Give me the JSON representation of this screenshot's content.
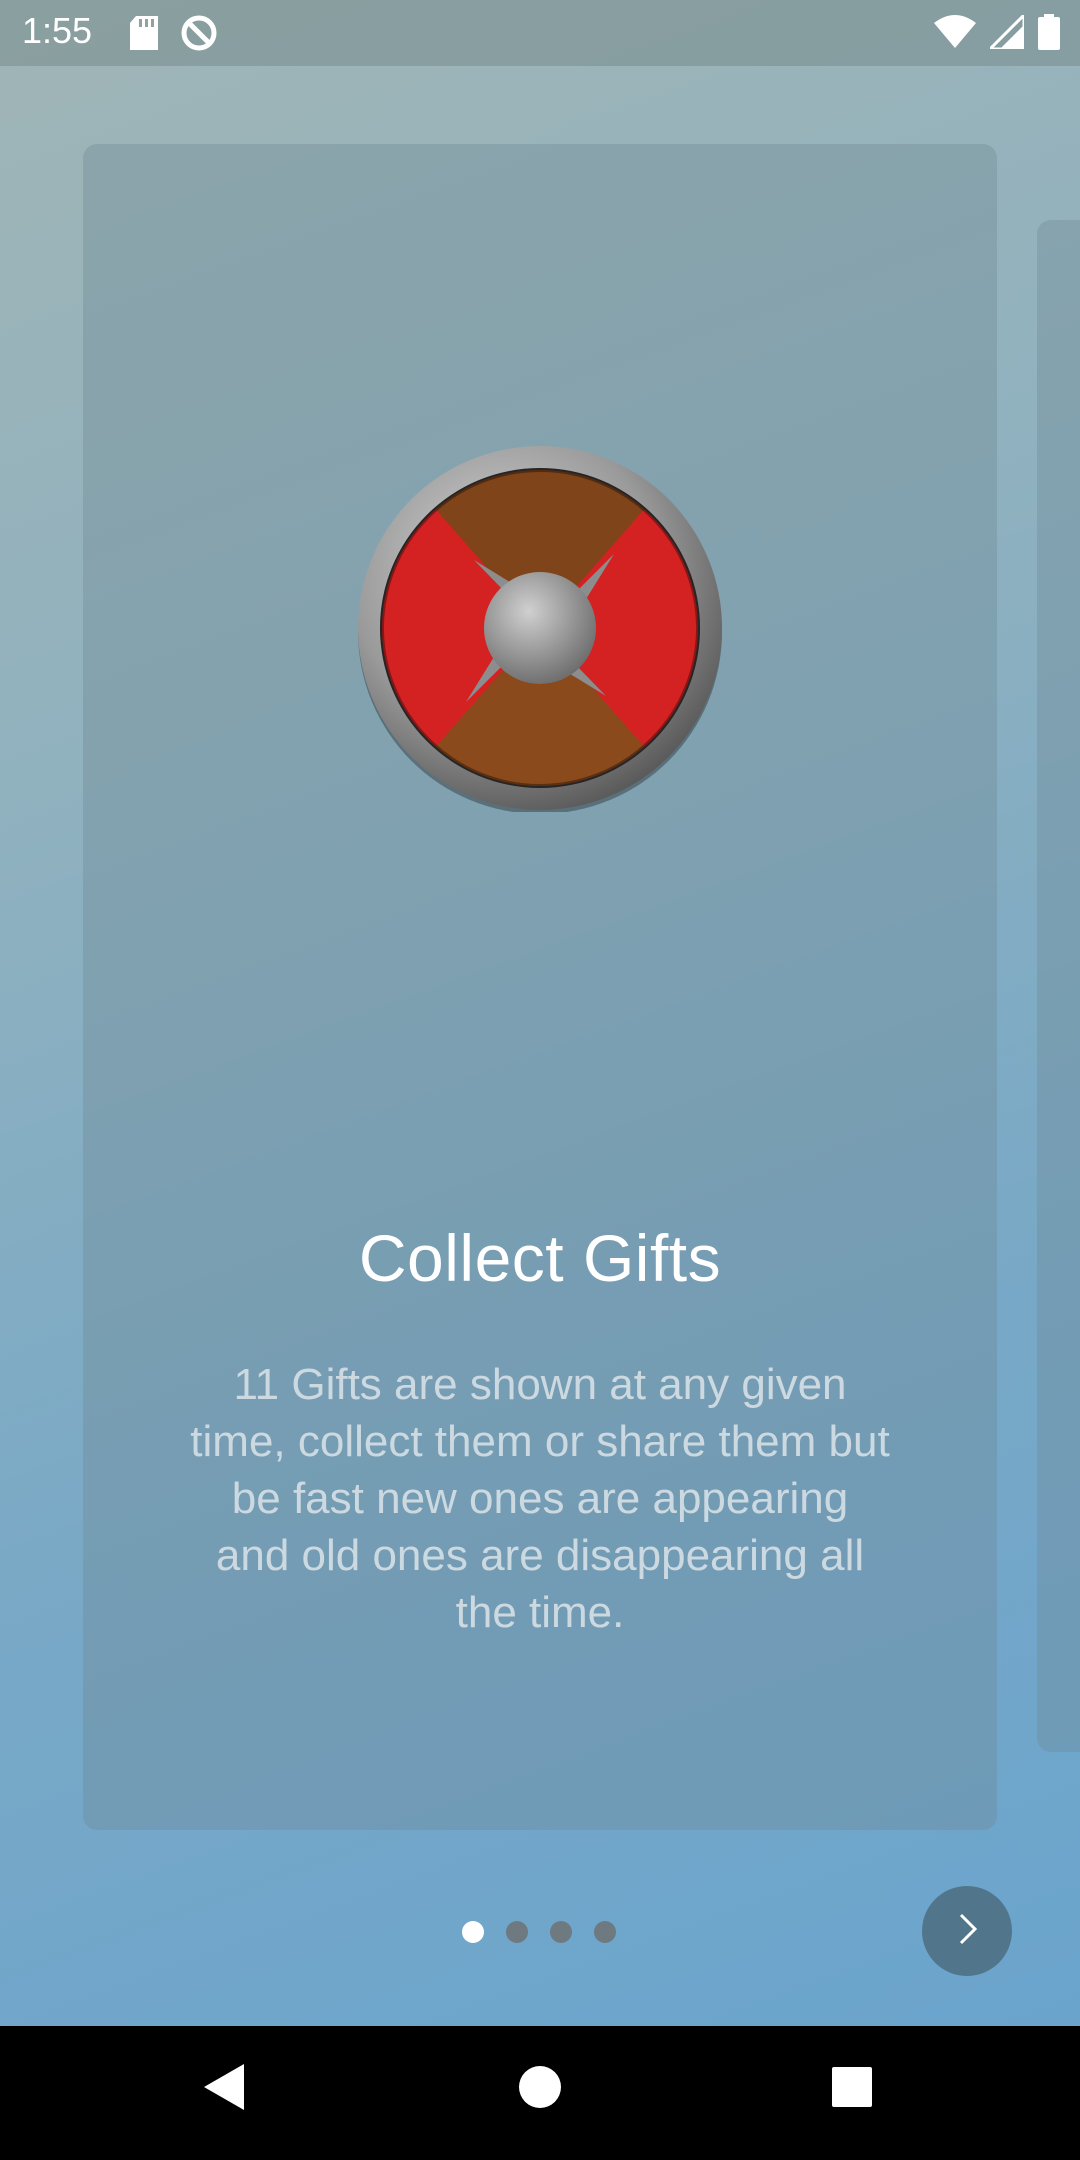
{
  "status_bar": {
    "time": "1:55",
    "icons": [
      "sd-card-icon",
      "do-not-disturb-icon",
      "wifi-icon",
      "signal-icon",
      "battery-icon"
    ]
  },
  "onboarding": {
    "current_page": 1,
    "total_pages": 4,
    "card": {
      "emblem_icon": "shield-emblem-icon",
      "title": "Collect Gifts",
      "description": "11 Gifts are shown at any given time, collect them or share them but be fast new ones are appearing and old ones are disappearing all the time."
    },
    "next_icon": "chevron-right-icon"
  },
  "navigation_bar": {
    "icons": [
      "back-icon",
      "home-icon",
      "recents-icon"
    ]
  },
  "colors": {
    "shield_red": "#d42222",
    "shield_brown": "#8a4a1c",
    "metal": "#9a9a9a",
    "dot_active": "#ffffff",
    "dot_inactive": "#6e7a80",
    "next_button": "#51758a"
  }
}
